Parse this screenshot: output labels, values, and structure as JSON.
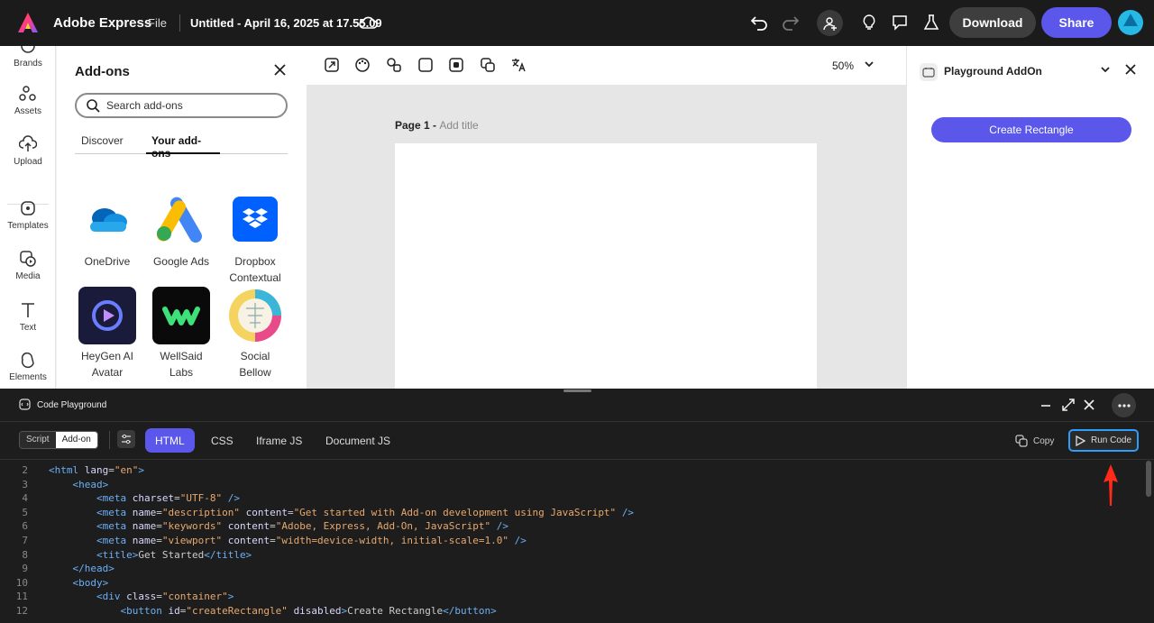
{
  "header": {
    "app_name": "Adobe Express",
    "file_menu": "File",
    "doc_title": "Untitled - April 16, 2025 at 17.55.09",
    "download_label": "Download",
    "share_label": "Share",
    "colors": {
      "share": "#5a57ea",
      "bg": "#1b1b1b"
    }
  },
  "rail": {
    "items": [
      {
        "label": "Brands",
        "icon": "brand-icon"
      },
      {
        "label": "Assets",
        "icon": "assets-icon"
      },
      {
        "label": "Upload",
        "icon": "upload-icon"
      },
      {
        "label": "Templates",
        "icon": "templates-icon"
      },
      {
        "label": "Media",
        "icon": "media-icon"
      },
      {
        "label": "Text",
        "icon": "text-icon"
      },
      {
        "label": "Elements",
        "icon": "elements-icon"
      }
    ]
  },
  "addons": {
    "title": "Add-ons",
    "search_placeholder": "Search add-ons",
    "tabs": [
      "Discover",
      "Your add-ons"
    ],
    "active_tab": "Your add-ons",
    "cards": [
      {
        "line1": "OneDrive",
        "line2": ""
      },
      {
        "line1": "Google Ads",
        "line2": ""
      },
      {
        "line1": "Dropbox",
        "line2": "Contextual"
      },
      {
        "line1": "HeyGen AI",
        "line2": "Avatar"
      },
      {
        "line1": "WellSaid",
        "line2": "Labs"
      },
      {
        "line1": "Social",
        "line2": "Bellow"
      }
    ]
  },
  "canvas": {
    "zoom": "50%",
    "page_label": "Page 1 - ",
    "page_title_placeholder": "Add title"
  },
  "right_panel": {
    "title": "Playground AddOn",
    "button_label": "Create Rectangle"
  },
  "playground": {
    "title": "Code Playground",
    "mode_options": [
      "Script",
      "Add-on"
    ],
    "active_mode": "Add-on",
    "lang_tabs": [
      "HTML",
      "CSS",
      "Iframe JS",
      "Document JS"
    ],
    "active_lang": "HTML",
    "copy_label": "Copy",
    "run_label": "Run Code",
    "line_numbers": [
      "2",
      "3",
      "4",
      "5",
      "6",
      "7",
      "8",
      "9",
      "10",
      "11",
      "12"
    ]
  }
}
